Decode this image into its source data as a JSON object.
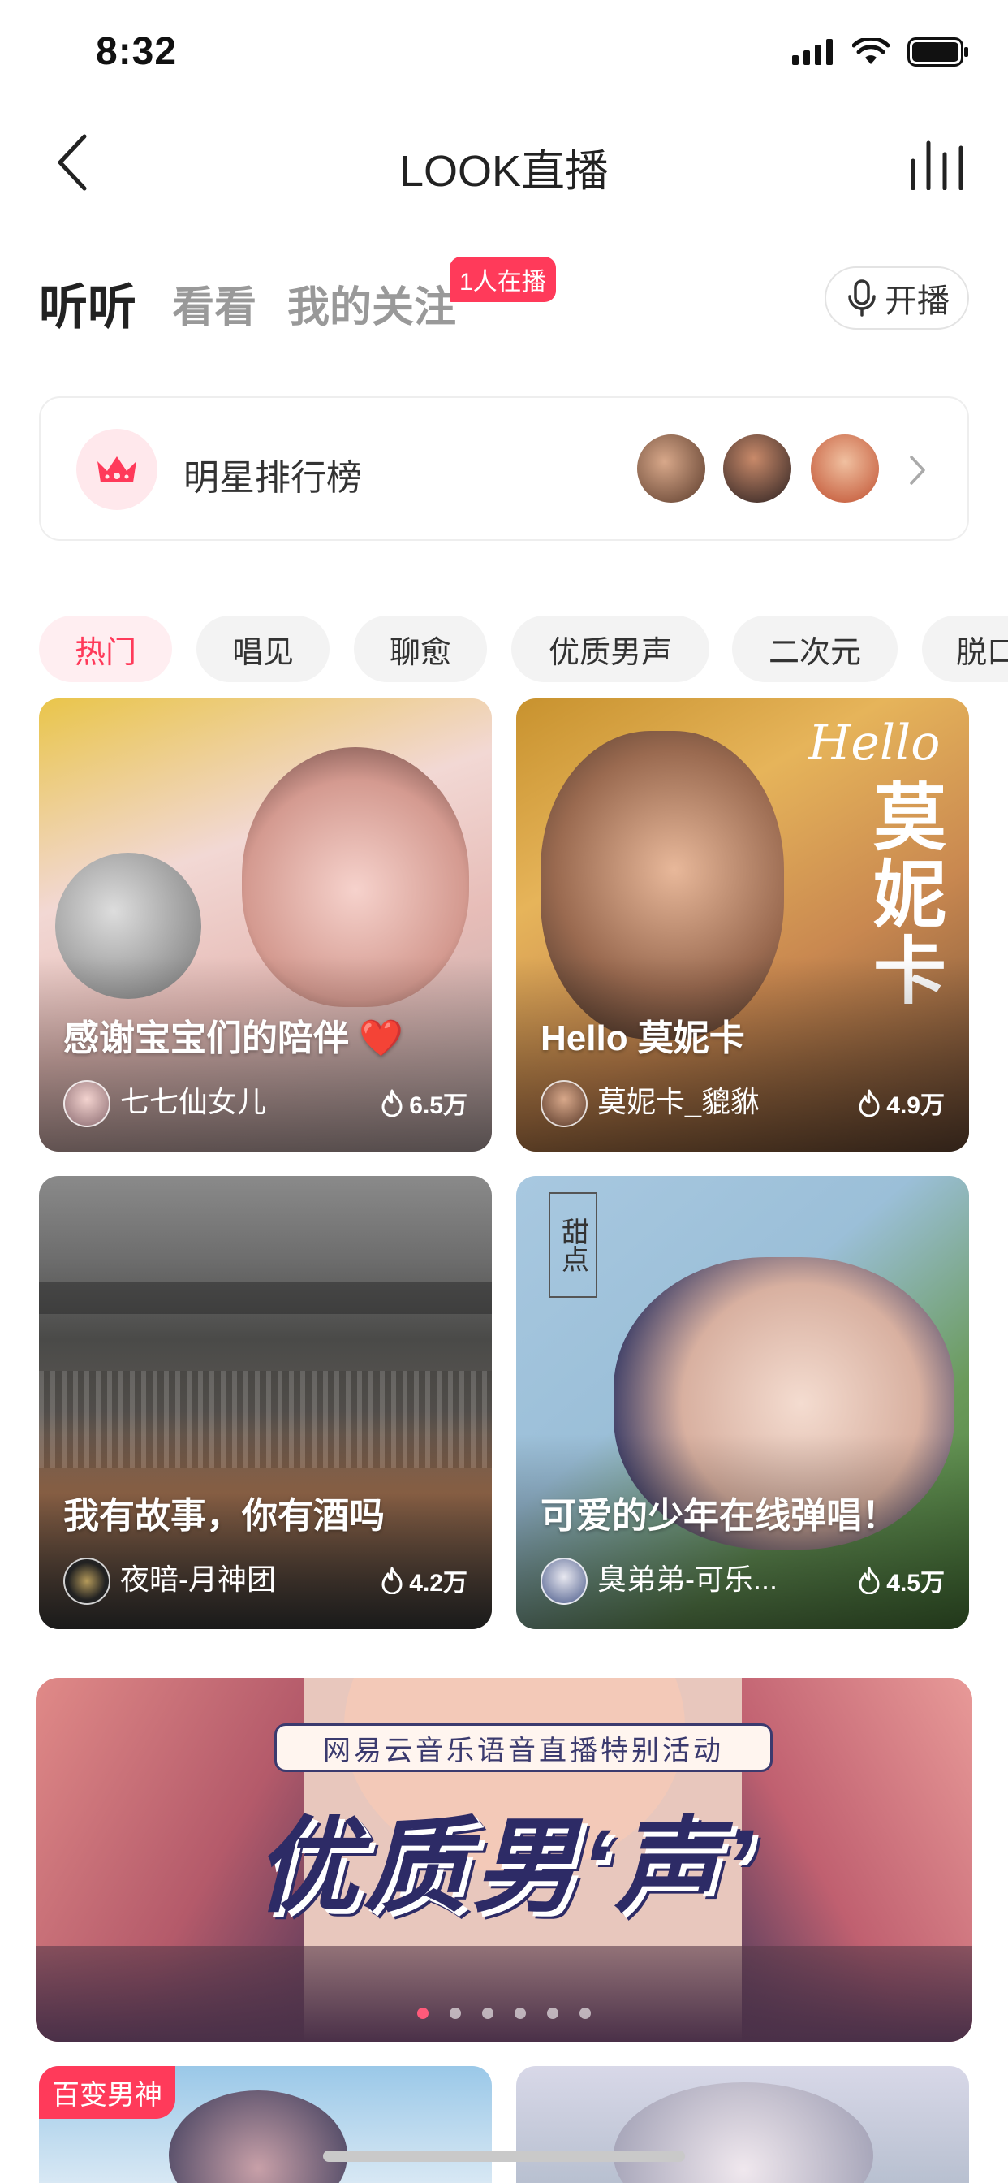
{
  "status": {
    "time": "8:32"
  },
  "nav": {
    "title": "LOOK直播"
  },
  "tabs": {
    "listen": "听听",
    "watch": "看看",
    "follow": "我的关注",
    "live_badge": "1人在播",
    "start_button": "开播"
  },
  "star_rank": {
    "label": "明星排行榜"
  },
  "categories": [
    "热门",
    "唱见",
    "聊愈",
    "优质男声",
    "二次元",
    "脱口"
  ],
  "cards": [
    {
      "title": "感谢宝宝们的陪伴 ❤️",
      "name": "七七仙女儿",
      "heat": "6.5万"
    },
    {
      "title": "Hello 莫妮卡",
      "name": "莫妮卡_貔貅",
      "heat": "4.9万",
      "overlay_text": "莫妮卡",
      "overlay_hello": "Hello"
    },
    {
      "title": "我有故事，你有酒吗",
      "name": "夜暗-月神团",
      "heat": "4.2万"
    },
    {
      "title": "可爱的少年在线弹唱！",
      "name": "臭弟弟-可乐...",
      "heat": "4.5万",
      "overlay_text": "甜点"
    }
  ],
  "banner": {
    "subtitle": "网易云音乐语音直播特别活动",
    "title": "优质男‘声’"
  },
  "bottom": {
    "tag": "百变男神"
  },
  "colors": {
    "accent": "#ff3a5a",
    "banner_text": "#2d2b66"
  }
}
